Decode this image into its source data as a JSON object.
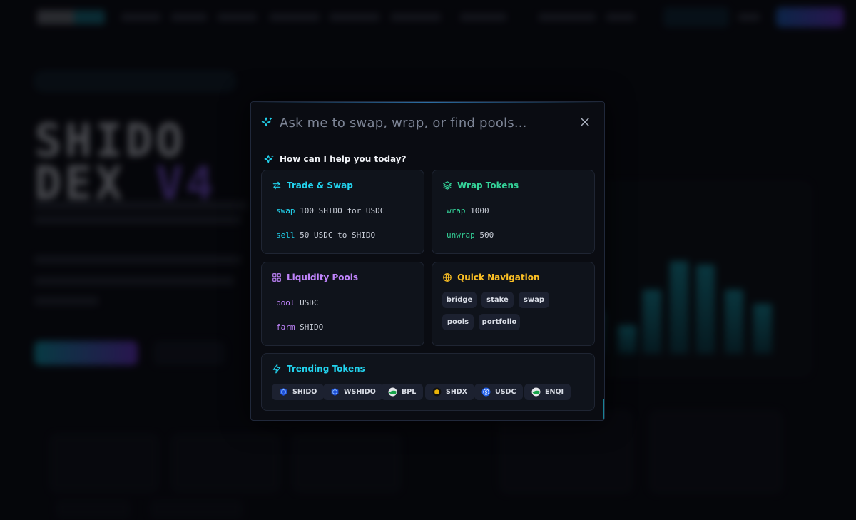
{
  "search": {
    "placeholder": "Ask me to swap, wrap, or find pools..."
  },
  "help_heading": "How can I help you today?",
  "sections": {
    "trade": {
      "title": "Trade & Swap",
      "color": "#22d3ee",
      "commands": [
        {
          "keyword": "swap",
          "args": "100 SHIDO for USDC"
        },
        {
          "keyword": "sell",
          "args": "50 USDC to SHIDO"
        }
      ]
    },
    "wrap": {
      "title": "Wrap Tokens",
      "color": "#34d399",
      "commands": [
        {
          "keyword": "wrap",
          "args": "1000"
        },
        {
          "keyword": "unwrap",
          "args": "500"
        }
      ]
    },
    "pools": {
      "title": "Liquidity Pools",
      "color": "#c084fc",
      "commands": [
        {
          "keyword": "pool",
          "args": "USDC"
        },
        {
          "keyword": "farm",
          "args": "SHIDO"
        }
      ]
    },
    "nav": {
      "title": "Quick Navigation",
      "color": "#fbbf24",
      "chips": [
        "bridge",
        "stake",
        "swap",
        "pools",
        "portfolio"
      ]
    },
    "trending": {
      "title": "Trending Tokens",
      "color": "#22d3ee",
      "tokens": [
        {
          "symbol": "SHIDO",
          "icon": "shido-hex-icon"
        },
        {
          "symbol": "WSHIDO",
          "icon": "wshido-hex-icon"
        },
        {
          "symbol": "BPL",
          "icon": "bpl-token-icon"
        },
        {
          "symbol": "SHDX",
          "icon": "shdx-token-icon"
        },
        {
          "symbol": "USDC",
          "icon": "usdc-token-icon"
        },
        {
          "symbol": "ENQI",
          "icon": "enqi-token-icon"
        }
      ]
    }
  },
  "background": {
    "hero_line1": "SHIDO",
    "hero_line2a": "DEX ",
    "hero_line2b": "V4"
  }
}
